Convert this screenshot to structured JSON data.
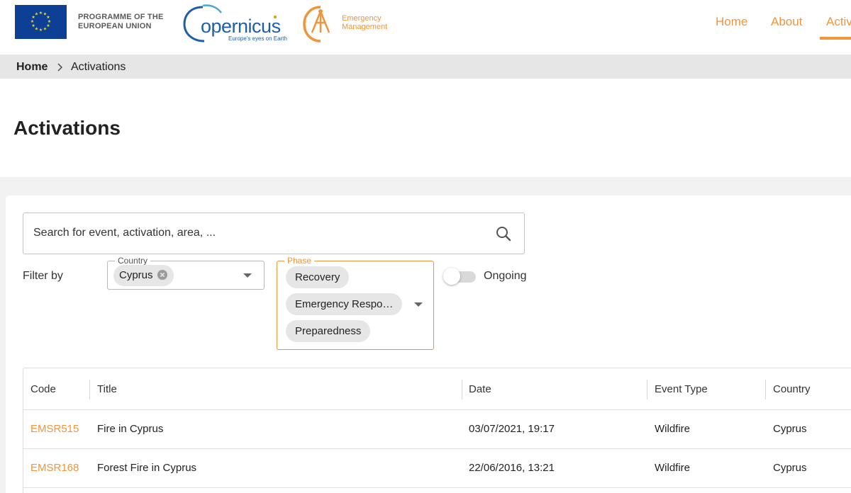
{
  "header": {
    "eu_programme_line1": "PROGRAMME OF THE",
    "eu_programme_line2": "EUROPEAN UNION",
    "copernicus_wordmark": "opernicus",
    "copernicus_tagline": "Europe's eyes on Earth",
    "ems_line1": "Emergency",
    "ems_line2": "Management",
    "brand_color": "#f0953a",
    "nav": [
      {
        "label": "Home"
      },
      {
        "label": "About"
      },
      {
        "label": "Activ",
        "active": true
      }
    ]
  },
  "breadcrumb": {
    "home": "Home",
    "current": "Activations"
  },
  "page_title": "Activations",
  "search": {
    "placeholder": "Search for event, activation, area, ..."
  },
  "filters": {
    "label": "Filter by",
    "country": {
      "legend": "Country",
      "selected": [
        "Cyprus"
      ]
    },
    "phase": {
      "legend": "Phase",
      "selected": [
        "Recovery",
        "Emergency Respo…",
        "Preparedness"
      ]
    },
    "ongoing": {
      "label": "Ongoing",
      "checked": false
    }
  },
  "table": {
    "columns": [
      "Code",
      "Title",
      "Date",
      "Event Type",
      "Country"
    ],
    "rows": [
      {
        "code": "EMSR515",
        "title": "Fire in Cyprus",
        "date": "03/07/2021, 19:17",
        "event_type": "Wildfire",
        "country": "Cyprus"
      },
      {
        "code": "EMSR168",
        "title": "Forest Fire in Cyprus",
        "date": "22/06/2016, 13:21",
        "event_type": "Wildfire",
        "country": "Cyprus"
      }
    ]
  }
}
